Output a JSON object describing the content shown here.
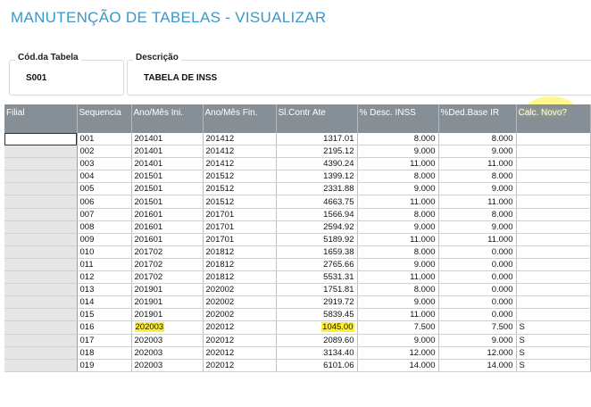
{
  "page": {
    "title": "MANUTENÇÃO DE TABELAS - VISUALIZAR"
  },
  "form": {
    "codigo_label": "Cód.da Tabela",
    "codigo_value": "S001",
    "descricao_label": "Descrição",
    "descricao_value": "TABELA DE INSS"
  },
  "colors": {
    "title": "#3a97c9",
    "header_bg": "#878f96",
    "highlight": "#ffef33"
  },
  "grid": {
    "columns": [
      "Filial",
      "Sequencia",
      "Ano/Mês Ini.",
      "Ano/Mês Fin.",
      "Sl.Contr Ate",
      "% Desc. INSS",
      "%Ded.Base IR",
      "Calc. Novo?"
    ],
    "rows": [
      [
        "",
        "001",
        "201401",
        "201412",
        "1317.01",
        "8.000",
        "8.000",
        ""
      ],
      [
        "",
        "002",
        "201401",
        "201412",
        "2195.12",
        "9.000",
        "9.000",
        ""
      ],
      [
        "",
        "003",
        "201401",
        "201412",
        "4390.24",
        "11.000",
        "11.000",
        ""
      ],
      [
        "",
        "004",
        "201501",
        "201512",
        "1399.12",
        "8.000",
        "8.000",
        ""
      ],
      [
        "",
        "005",
        "201501",
        "201512",
        "2331.88",
        "9.000",
        "9.000",
        ""
      ],
      [
        "",
        "006",
        "201501",
        "201512",
        "4663.75",
        "11.000",
        "11.000",
        ""
      ],
      [
        "",
        "007",
        "201601",
        "201701",
        "1566.94",
        "8.000",
        "8.000",
        ""
      ],
      [
        "",
        "008",
        "201601",
        "201701",
        "2594.92",
        "9.000",
        "9.000",
        ""
      ],
      [
        "",
        "009",
        "201601",
        "201701",
        "5189.92",
        "11.000",
        "11.000",
        ""
      ],
      [
        "",
        "010",
        "201702",
        "201812",
        "1659.38",
        "8.000",
        "0.000",
        ""
      ],
      [
        "",
        "011",
        "201702",
        "201812",
        "2765.66",
        "9.000",
        "0.000",
        ""
      ],
      [
        "",
        "012",
        "201702",
        "201812",
        "5531.31",
        "11.000",
        "0.000",
        ""
      ],
      [
        "",
        "013",
        "201901",
        "202002",
        "1751.81",
        "8.000",
        "0.000",
        ""
      ],
      [
        "",
        "014",
        "201901",
        "202002",
        "2919.72",
        "9.000",
        "0.000",
        ""
      ],
      [
        "",
        "015",
        "201901",
        "202002",
        "5839.45",
        "11.000",
        "0.000",
        ""
      ],
      [
        "",
        "016",
        "202003",
        "202012",
        "1045.00",
        "7.500",
        "7.500",
        "S"
      ],
      [
        "",
        "017",
        "202003",
        "202012",
        "2089.60",
        "9.000",
        "9.000",
        "S"
      ],
      [
        "",
        "018",
        "202003",
        "202012",
        "3134.40",
        "12.000",
        "12.000",
        "S"
      ],
      [
        "",
        "019",
        "202003",
        "202012",
        "6101.06",
        "14.000",
        "14.000",
        "S"
      ]
    ],
    "highlighted_row_index": 15
  }
}
